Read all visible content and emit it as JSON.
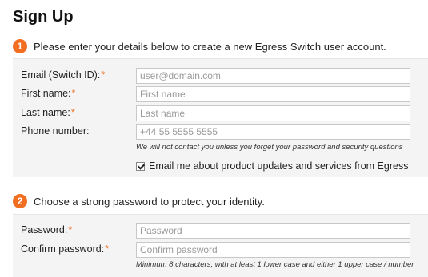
{
  "page": {
    "title": "Sign Up"
  },
  "steps": [
    {
      "number": "1",
      "text": "Please enter your details below to create a new Egress Switch user account."
    },
    {
      "number": "2",
      "text": "Choose a strong password to protect your identity."
    }
  ],
  "account": {
    "email": {
      "label": "Email (Switch ID):",
      "required": "*",
      "placeholder": "user@domain.com",
      "value": ""
    },
    "first_name": {
      "label": "First name:",
      "required": "*",
      "placeholder": "First name",
      "value": ""
    },
    "last_name": {
      "label": "Last name:",
      "required": "*",
      "placeholder": "Last name",
      "value": ""
    },
    "phone": {
      "label": "Phone number:",
      "placeholder": "+44 55 5555 5555",
      "value": ""
    },
    "phone_hint": "We will not contact you unless you forget your password and security questions",
    "marketing": {
      "label": "Email me about product updates and services from Egress",
      "checked": true
    }
  },
  "password": {
    "password": {
      "label": "Password:",
      "required": "*",
      "placeholder": "Password",
      "value": ""
    },
    "confirm": {
      "label": "Confirm password:",
      "required": "*",
      "placeholder": "Confirm password",
      "value": ""
    },
    "hint": "Minimum 8 characters, with at least 1 lower case and either 1 upper case / number"
  },
  "colors": {
    "accent": "#f26f21",
    "panel": "#f4f4f4",
    "border": "#c8c8c8"
  }
}
